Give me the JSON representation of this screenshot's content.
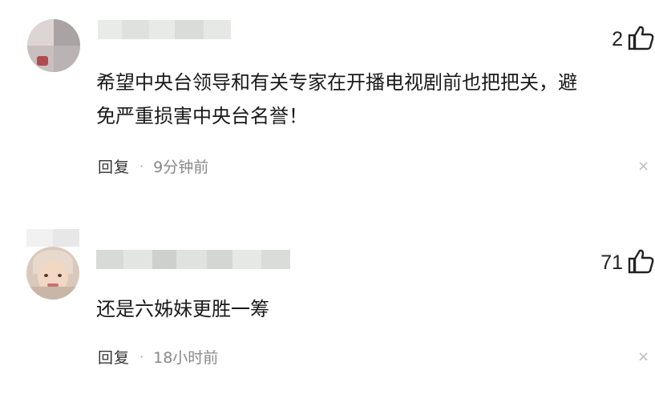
{
  "comments": [
    {
      "likes": "2",
      "content_line1": "希望中央台领导和有关专家在开播电视剧前也把把关，避",
      "content_line2": "免严重损害中央台名誉！",
      "reply_label": "回复",
      "dot": "·",
      "time": "9分钟前",
      "close": "×"
    },
    {
      "likes": "71",
      "content_line1": "还是六姊妹更胜一筹",
      "reply_label": "回复",
      "dot": "·",
      "time": "18小时前",
      "close": "×"
    }
  ],
  "icons": {
    "like": "thumbs-up-icon",
    "close": "close-icon",
    "avatar": "user-avatar"
  },
  "colors": {
    "text": "#1a1a1a",
    "muted": "#888888",
    "mosaic_light": "#e4e6e4",
    "mosaic_mid": "#cfd2cf",
    "mosaic_dark": "#b9bdb9"
  }
}
